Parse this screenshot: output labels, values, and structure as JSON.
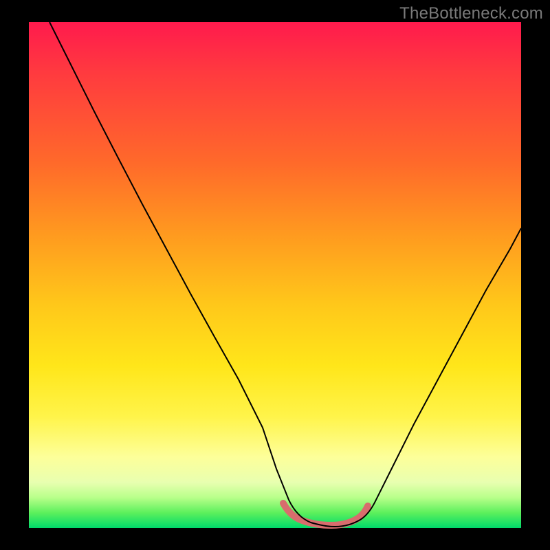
{
  "watermark": "TheBottleneck.com",
  "colors": {
    "frame": "#000000",
    "gradient_top": "#ff1a4d",
    "gradient_bottom": "#00d96a",
    "curve": "#000000",
    "bottom_highlight": "#d86d6d"
  },
  "chart_data": {
    "type": "line",
    "title": "",
    "xlabel": "",
    "ylabel": "",
    "xlim": [
      0,
      100
    ],
    "ylim": [
      0,
      100
    ],
    "series": [
      {
        "name": "bottleneck-curve",
        "x": [
          5,
          10,
          15,
          20,
          25,
          30,
          35,
          40,
          45,
          50,
          52,
          55,
          58,
          60,
          62,
          65,
          70,
          75,
          80,
          85,
          90,
          95,
          100
        ],
        "y": [
          100,
          92,
          84,
          75,
          66,
          57,
          48,
          39,
          30,
          20,
          12,
          6,
          2,
          0,
          0,
          2,
          8,
          17,
          27,
          37,
          47,
          56,
          62
        ]
      }
    ],
    "annotations": [
      {
        "name": "sweet-spot-band",
        "x_start": 52,
        "x_end": 68,
        "y": 0
      }
    ]
  }
}
